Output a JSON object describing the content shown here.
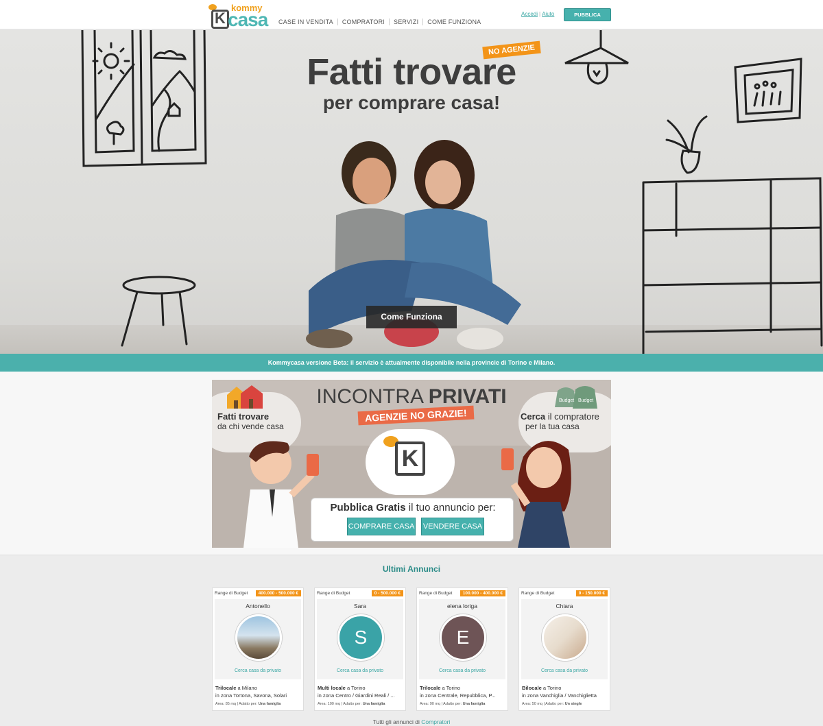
{
  "header": {
    "logo_top": "kommy",
    "logo_bottom": "casa",
    "logo_k": "K",
    "nav": [
      "CASE IN VENDITA",
      "COMPRATORI",
      "SERVIZI",
      "COME FUNZIONA"
    ],
    "login": "Accedi",
    "help": "Aiuto",
    "publish": "PUBBLICA GRATIS"
  },
  "hero": {
    "title": "Fatti trovare",
    "subtitle": "per comprare casa!",
    "badge": "NO AGENZIE",
    "cta": "Come Funziona"
  },
  "beta_notice": "Kommycasa versione Beta: il servizio è attualmente disponibile nella provincie di Torino e Milano.",
  "promo": {
    "title_light": "INCONTRA ",
    "title_bold": "PRIVATI",
    "ribbon": "AGENZIE NO GRAZIE!",
    "left_bold": "Fatti trovare",
    "left_sub": "da chi vende casa",
    "right_bold": "Cerca",
    "right_rest": " il compratore",
    "right_sub": "per la tua casa",
    "bag_label": "Budget",
    "k_letter": "K",
    "publish_bold": "Pubblica Gratis",
    "publish_rest": " il tuo annuncio per:",
    "buy_button": "COMPRARE CASA",
    "sell_button": "VENDERE CASA"
  },
  "listings": {
    "title": "Ultimi Annunci",
    "range_label": "Range di Budget",
    "search_label": "Cerca casa da privato",
    "area_label": "Area:",
    "fit_label": "Adatto per:",
    "items": [
      {
        "range": "400.000 - 500.000 €",
        "name": "Antonello",
        "type": "Trilocale",
        "city": "a Milano",
        "zone": "in zona Tortona, Savona, Solari",
        "area": "85 mq",
        "fit": "Una famiglia",
        "avatar_color": "#6f8fa8",
        "initial": ""
      },
      {
        "range": "0 - 500.000 €",
        "name": "Sara",
        "type": "Multi locale",
        "city": "a Torino",
        "zone": "in zona Centro / Giardini Reali / ...",
        "area": "100 mq",
        "fit": "Una famiglia",
        "avatar_color": "#3aa3a7",
        "initial": "S"
      },
      {
        "range": "100.000 - 400.000 €",
        "name": "elena loriga",
        "type": "Trilocale",
        "city": "a Torino",
        "zone": "in zona Centrale, Repubblica, P...",
        "area": "90 mq",
        "fit": "Una famiglia",
        "avatar_color": "#6e5456",
        "initial": "E"
      },
      {
        "range": "0 - 150.000 €",
        "name": "Chiara",
        "type": "Bilocale",
        "city": "a Torino",
        "zone": "in zona Vanchiglia / Vanchiglietta",
        "area": "50 mq",
        "fit": "Un single",
        "avatar_color": "#e9ddd0",
        "initial": ""
      }
    ],
    "all_prefix": "Tutti gli annunci di ",
    "all_link": "Compratori"
  }
}
